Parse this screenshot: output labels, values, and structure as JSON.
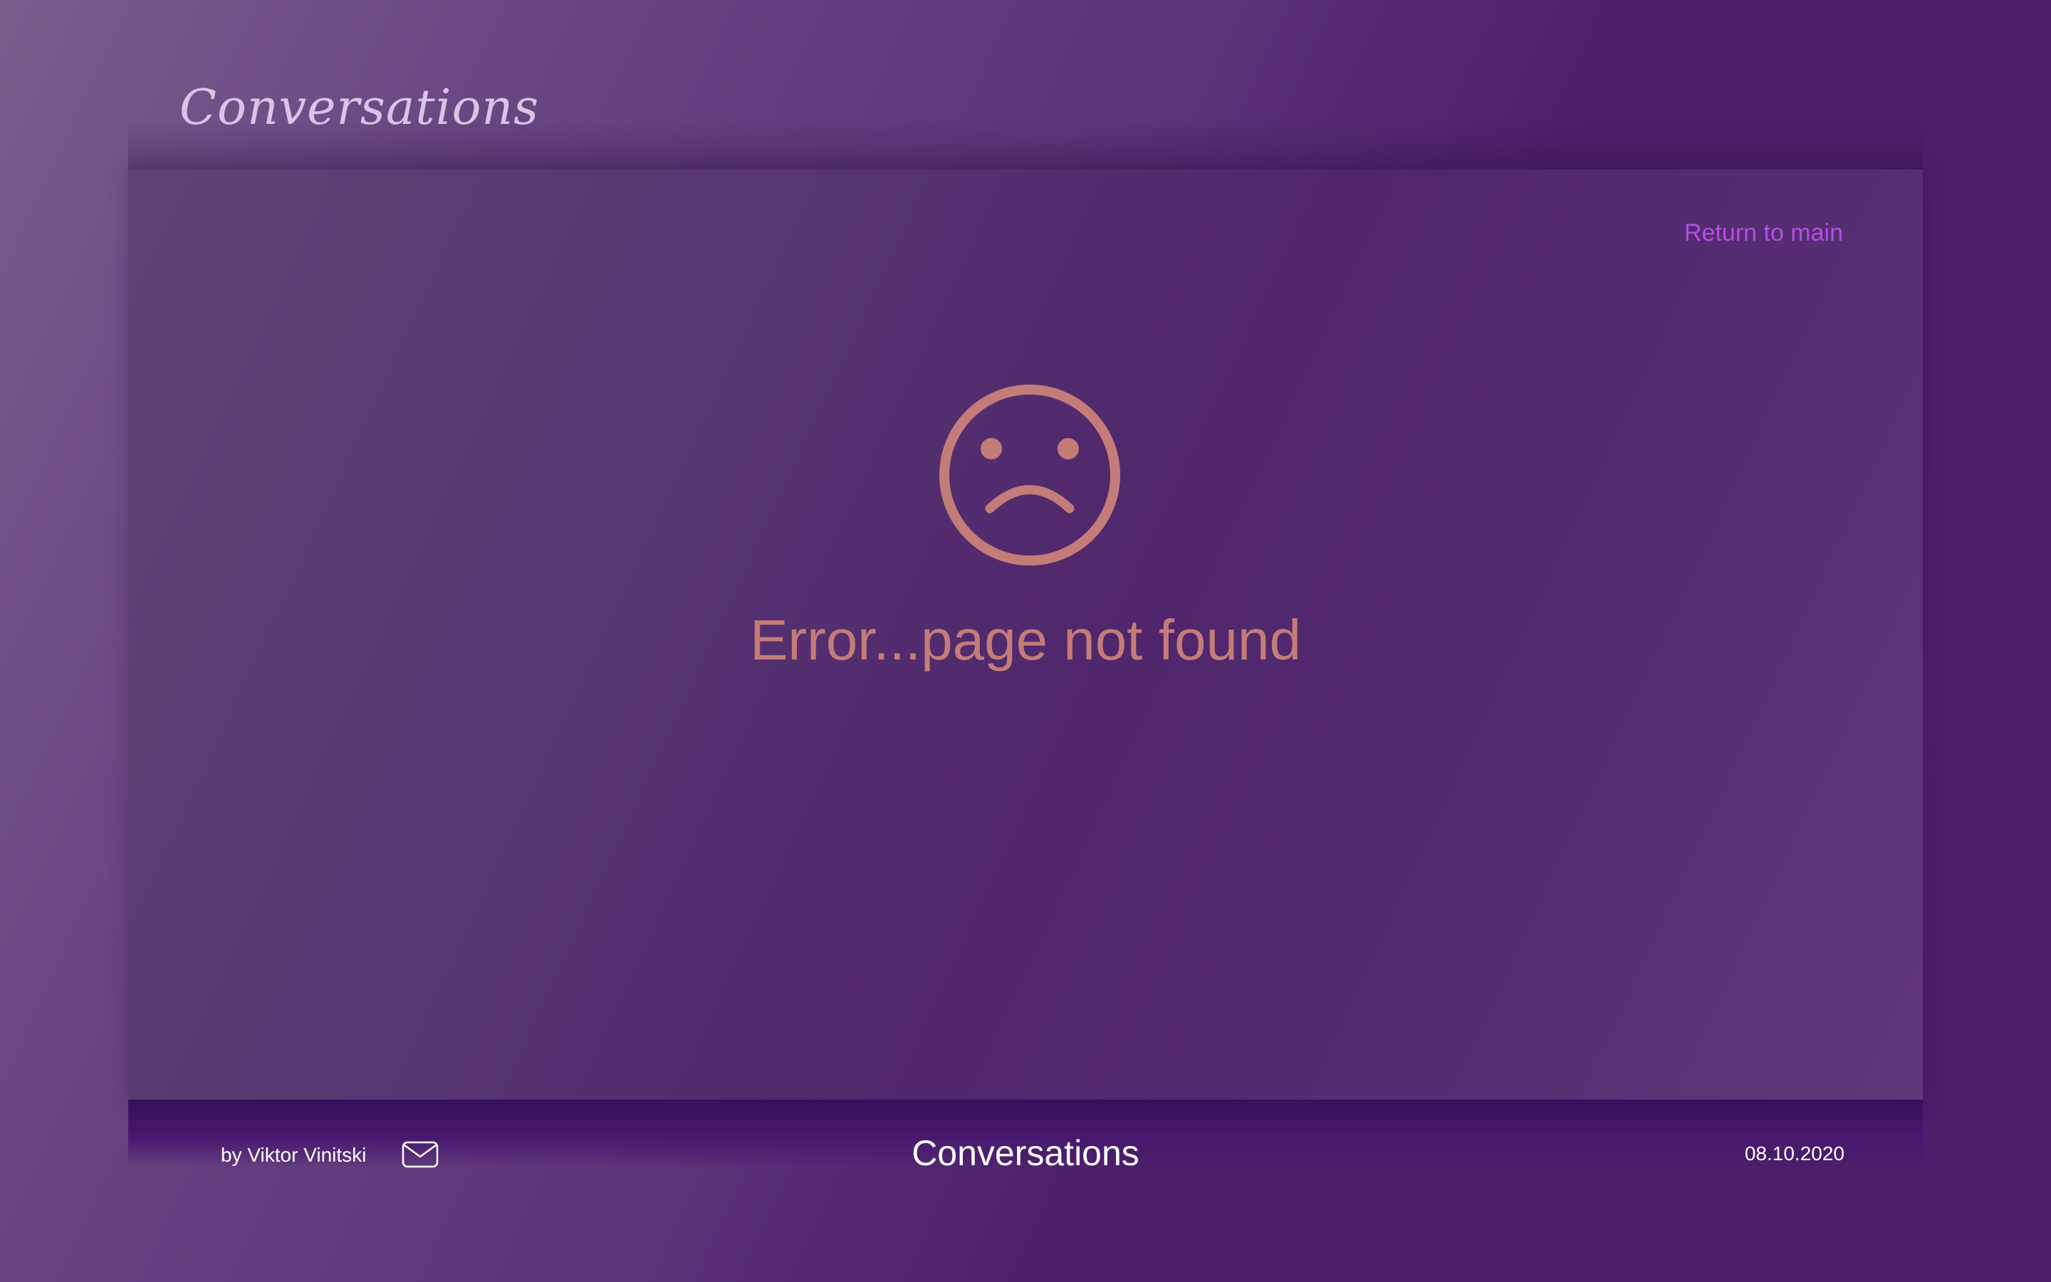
{
  "header": {
    "logo_text": "Conversations"
  },
  "main": {
    "return_link_label": "Return to main",
    "error_icon": "sad-face-icon",
    "error_message": "Error...page not found"
  },
  "footer": {
    "author": "by Viktor Vinitski",
    "mail_icon": "envelope-icon",
    "title": "Conversations",
    "date": "08.10.2020"
  },
  "colors": {
    "accent_link": "#b34fe0",
    "error": "#c47c78",
    "background": "#4b1f6a"
  }
}
